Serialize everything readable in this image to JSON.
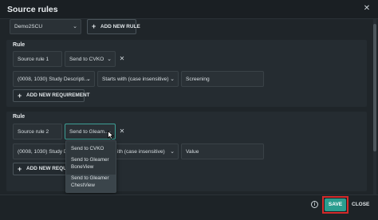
{
  "dialog": {
    "title": "Source rules",
    "close_icon": "close-icon"
  },
  "source_select": {
    "value": "Demo2SCU",
    "add_rule_label": "ADD NEW RULE"
  },
  "rules": [
    {
      "label": "Rule",
      "name": "Source rule 1",
      "target": "Send to CVKO",
      "requirement": {
        "tag": "(0008, 1030) Study Descripti...",
        "operator": "Starts with (case insensitive)",
        "value": "Screening"
      },
      "add_requirement_label": "ADD NEW REQUIREMENT"
    },
    {
      "label": "Rule",
      "name": "Source rule 2",
      "target": "Send to Gleam...",
      "requirement": {
        "tag": "(0008, 1030) Study Des",
        "operator": "ith (case insensitive)",
        "value": "Value"
      },
      "add_requirement_label": "ADD NEW REQUIR"
    }
  ],
  "dropdown": {
    "options": [
      "Send to CVKO",
      "Send to Gleamer BoneView",
      "Send to Gleamer ChestView"
    ],
    "highlighted_index": 2
  },
  "footer": {
    "info_icon": "info-icon",
    "save_label": "SAVE",
    "close_label": "CLOSE"
  },
  "colors": {
    "accent": "#2a9d8f",
    "highlight_outline": "#d22a2a",
    "background": "#1f2529"
  }
}
